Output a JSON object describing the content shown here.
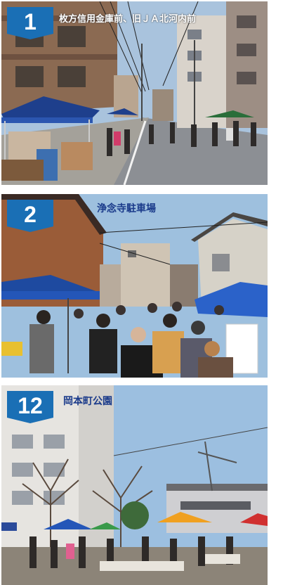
{
  "panels": [
    {
      "number": "1",
      "caption": "枚方信用金庫前、旧ＪＡ北河内前"
    },
    {
      "number": "2",
      "caption": "浄念寺駐車場"
    },
    {
      "number": "12",
      "caption": "岡本町公園"
    }
  ],
  "colors": {
    "badge": "#1a6fb5",
    "caption_blue": "#1a3a8a"
  }
}
